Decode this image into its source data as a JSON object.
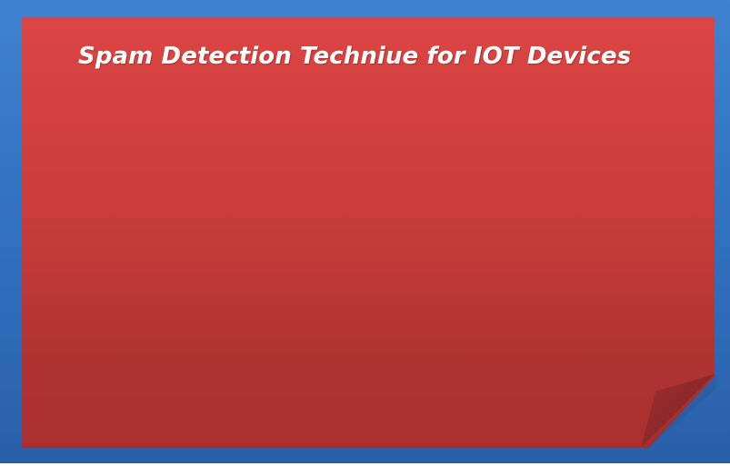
{
  "slide": {
    "title": "Spam Detection Techniue for IOT Devices"
  },
  "colors": {
    "frame_blue": "#3f82cf",
    "note_red": "#dc4543",
    "curl_red": "#8b2828",
    "title_text": "#ffffff"
  },
  "icons": {
    "note": "sticky-note-icon"
  }
}
